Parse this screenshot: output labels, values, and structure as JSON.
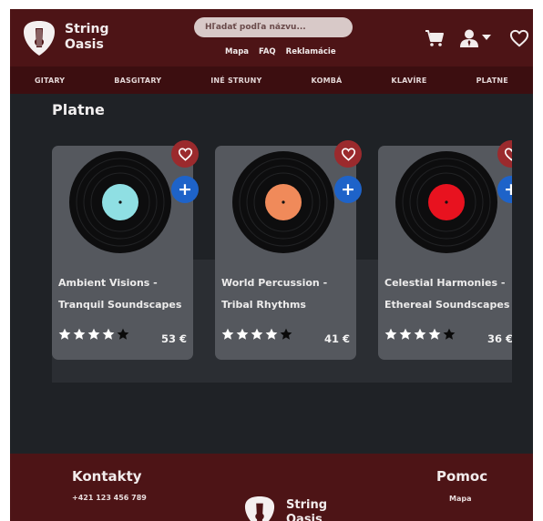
{
  "header": {
    "brand_line1": "String",
    "brand_line2": "Oasis",
    "search_placeholder": "Hľadať podľa názvu...",
    "links": [
      "Mapa",
      "FAQ",
      "Reklamácie"
    ]
  },
  "categories": [
    "GITARY",
    "BASGITARY",
    "INÉ STRUNY",
    "KOMBÁ",
    "KLAVÍRE",
    "PLATNE"
  ],
  "page": {
    "title": "Platne"
  },
  "products": [
    {
      "title": "Ambient Visions - Tranquil Soundscapes",
      "price": "53 €",
      "rating": 4,
      "label_color": "#8fdfe3"
    },
    {
      "title": "World Percussion - Tribal Rhythms",
      "price": "41 €",
      "rating": 4,
      "label_color": "#f08a5a"
    },
    {
      "title": "Celestial Harmonies - Ethereal Soundscapes",
      "price": "36 €",
      "rating": 4,
      "label_color": "#e8121f"
    }
  ],
  "footer": {
    "contacts_title": "Kontakty",
    "phone": "+421 123 456 789",
    "brand_line1": "String",
    "brand_line2": "Oasis",
    "help_title": "Pomoc",
    "help_link": "Mapa"
  },
  "colors": {
    "header_bg": "#4d1416",
    "nav_bg": "#3c0e10",
    "page_bg": "#1f2226",
    "card_bg": "#55585e",
    "favorite_bg": "#9b2a2d",
    "add_bg": "#1e63c9"
  },
  "icons": {
    "logo": "guitar-pick-logo",
    "cart": "cart-icon",
    "user": "user-icon",
    "wishlist": "heart-icon",
    "favorite": "heart-icon",
    "add": "plus-icon"
  }
}
